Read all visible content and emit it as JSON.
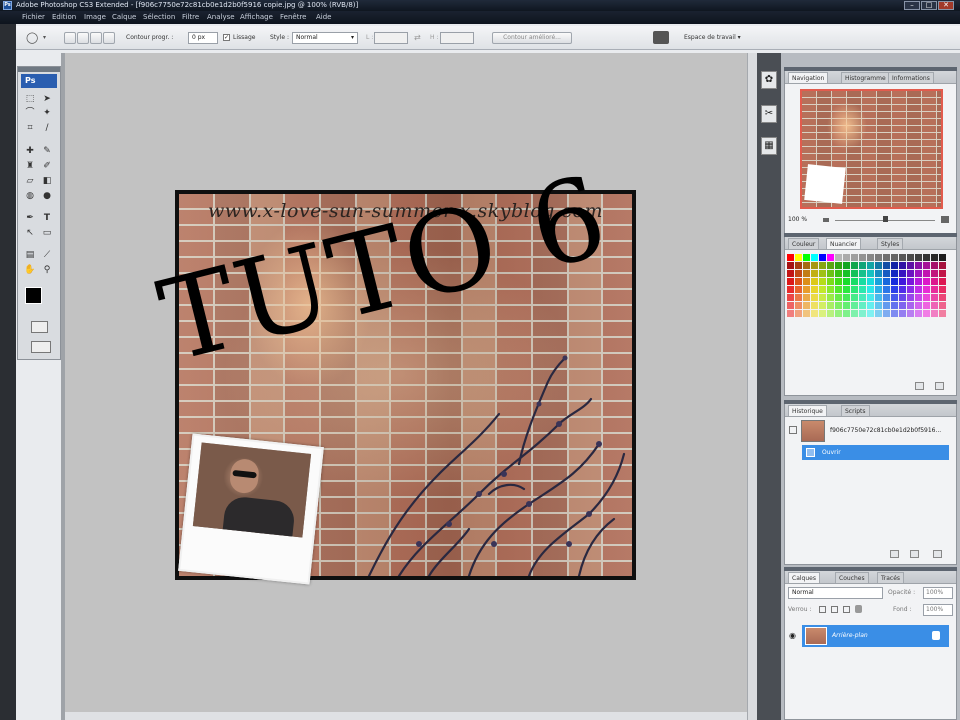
{
  "window": {
    "title": "Adobe Photoshop CS3 Extended - [f906c7750e72c81cb0e1d2b0f5916 copie.jpg @ 100% (RVB/8)]",
    "app_icon": "Ps",
    "controls": {
      "minimize": "–",
      "maximize": "□",
      "close": "✕"
    }
  },
  "menubar": {
    "items": [
      "Fichier",
      "Edition",
      "Image",
      "Calque",
      "Sélection",
      "Filtre",
      "Analyse",
      "Affichage",
      "Fenêtre",
      "Aide"
    ]
  },
  "options": {
    "contour_label": "Contour progr. :",
    "contour_value": "0 px",
    "lissage_label": "Lissage",
    "style_label": "Style :",
    "style_value": "Normal",
    "width_label": "L :",
    "height_label": "H :",
    "refine_label": "Contour amélioré...",
    "workspace_label": "Espace de travail ▾"
  },
  "tools": {
    "logo": "Ps",
    "items": [
      "marquee-icon",
      "move-icon",
      "lasso-icon",
      "magic-wand-icon",
      "crop-icon",
      "slice-icon",
      "heal-icon",
      "brush-icon",
      "stamp-icon",
      "history-brush-icon",
      "eraser-icon",
      "gradient-icon",
      "blur-icon",
      "dodge-icon",
      "pen-icon",
      "type-icon",
      "path-select-icon",
      "shape-icon",
      "notes-icon",
      "eyedropper-icon",
      "hand-icon",
      "zoom-icon"
    ]
  },
  "document": {
    "watermark": "www.x-love-sun-summer-x.skyblog.com",
    "overlay_text": "TUTO 6"
  },
  "panels": {
    "navigator": {
      "tabs": [
        "Navigation",
        "Histogramme",
        "Informations"
      ],
      "zoom": "100 %"
    },
    "swatches": {
      "tabs": [
        "Couleur",
        "Nuancier",
        "Styles"
      ]
    },
    "history": {
      "tabs": [
        "Historique",
        "Scripts"
      ],
      "snapshot": "f906c7750e72c81cb0e1d2b0f5916...",
      "state": "Ouvrir"
    },
    "layers": {
      "tabs": [
        "Calques",
        "Couches",
        "Tracés"
      ],
      "blend_mode": "Normal",
      "opacity_label": "Opacité :",
      "opacity_value": "100%",
      "lock_label": "Verrou :",
      "fill_label": "Fond :",
      "fill_value": "100%",
      "layer_name": "Arrière-plan"
    }
  },
  "colors": {
    "accent": "#3a8ee6",
    "nav_frame": "#e25b4d"
  }
}
